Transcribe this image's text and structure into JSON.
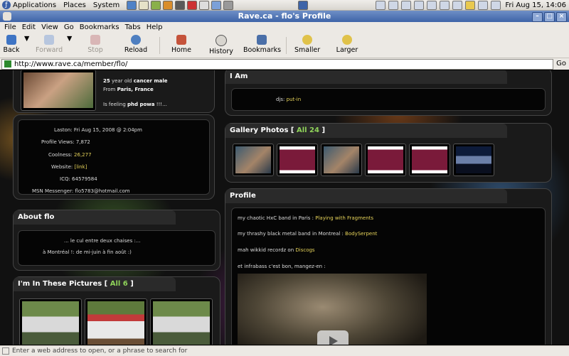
{
  "panel": {
    "menus": [
      "Applications",
      "Places",
      "System"
    ],
    "clock": "Fri Aug 15, 14:06"
  },
  "window": {
    "title": "Rave.ca - flo's Profile"
  },
  "menubar": [
    "File",
    "Edit",
    "View",
    "Go",
    "Bookmarks",
    "Tabs",
    "Help"
  ],
  "toolbar": {
    "back": "Back",
    "forward": "Forward",
    "stop": "Stop",
    "reload": "Reload",
    "home": "Home",
    "history": "History",
    "bookmarks": "Bookmarks",
    "smaller": "Smaller",
    "larger": "Larger"
  },
  "location": {
    "url": "http://www.rave.ca/member/flo/",
    "go": "Go"
  },
  "profile": {
    "age": "25",
    "age_suffix": " year old ",
    "desc": "cancer male",
    "from_label": "From ",
    "from_value": "Paris, France",
    "feeling_label": "Is feeling ",
    "feeling_value": "phd powa",
    "feeling_suffix": " !!!..."
  },
  "stats": {
    "laston": "Laston: Fri Aug 15, 2008 @ 2:04pm",
    "views": "Profile Views: 7,872",
    "coolness_label": "Coolness: ",
    "coolness_value": "26,277",
    "website_label": "Website: ",
    "website_value": "[link]",
    "icq": "ICQ: 64579584",
    "msn": "MSN Messenger: flo5783@hotmail.com"
  },
  "about": {
    "header": "About flo",
    "line1": "... le cul entre deux chaises :...",
    "line2": "à Montréal !: de mi-juin à fin août :)"
  },
  "pictures": {
    "header": "I'm In These Pictures [ ",
    "link": "All 6",
    "close": " ]"
  },
  "iam": {
    "header": "I Am",
    "label": "djs: ",
    "value": "put-in"
  },
  "gallery": {
    "header": "Gallery Photos [ ",
    "link": "All 24",
    "close": " ]"
  },
  "profile_section": {
    "header": "Profile",
    "l1_text": "my chaotic HxC band in Paris : ",
    "l1_link": "Playing with Fragments",
    "l2_text": "my thrashy black metal band in Montreal : ",
    "l2_link": "BodySerpent",
    "l3_text": "mah wikkid recordz on ",
    "l3_link": "Discogs",
    "l4_text": "et infrabass c'est bon, mangez-en :"
  },
  "status": "Enter a web address to open, or a phrase to search for",
  "colors": {
    "accent": "#3e64a8",
    "link_green": "#8fd35a",
    "link_yellow": "#e6d35a"
  }
}
